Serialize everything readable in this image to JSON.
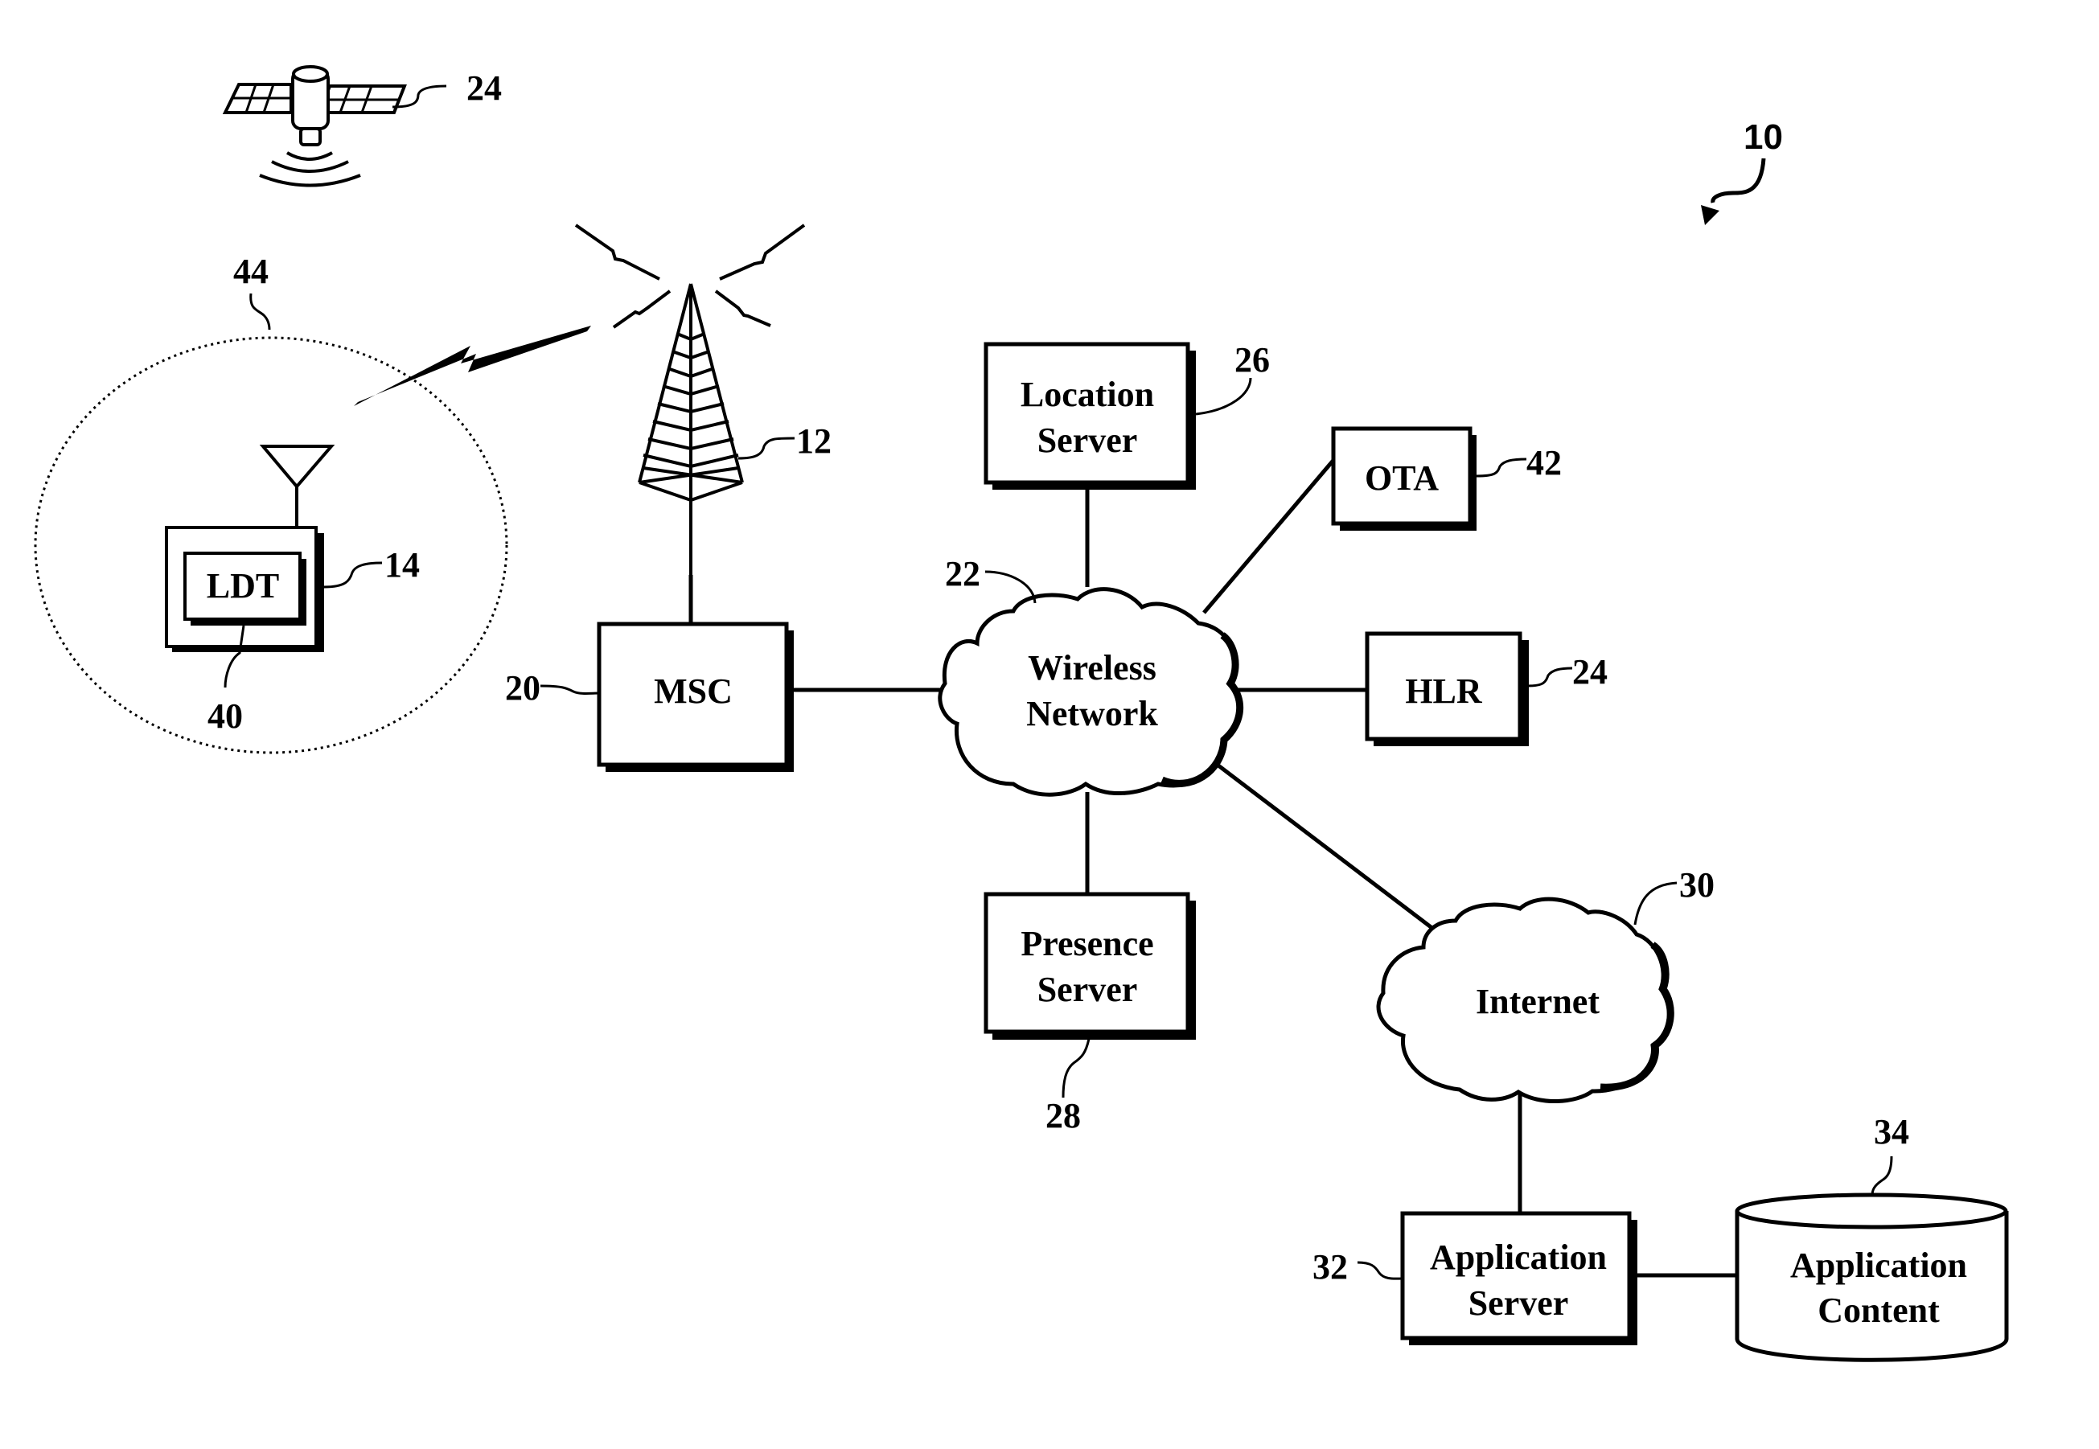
{
  "figure": {
    "reference": "10",
    "nodes": {
      "satellite": {
        "ref": "24",
        "icon": "satellite-icon"
      },
      "tower": {
        "ref": "12",
        "icon": "cell-tower-icon"
      },
      "coverage_area": {
        "ref": "44"
      },
      "device": {
        "ref": "14",
        "label": "LDT",
        "ldt_ref": "40"
      },
      "msc": {
        "ref": "20",
        "lines": [
          "MSC"
        ]
      },
      "wireless_network": {
        "ref": "22",
        "lines": [
          "Wireless",
          "Network"
        ]
      },
      "location_server": {
        "ref": "26",
        "lines": [
          "Location",
          "Server"
        ]
      },
      "ota": {
        "ref": "42",
        "lines": [
          "OTA"
        ]
      },
      "hlr": {
        "ref": "24",
        "lines": [
          "HLR"
        ]
      },
      "presence_server": {
        "ref": "28",
        "lines": [
          "Presence",
          "Server"
        ]
      },
      "internet": {
        "ref": "30",
        "lines": [
          "Internet"
        ]
      },
      "application_server": {
        "ref": "32",
        "lines": [
          "Application",
          "Server"
        ]
      },
      "application_content": {
        "ref": "34",
        "lines": [
          "Application",
          "Content"
        ]
      }
    },
    "connections": [
      [
        "tower",
        "msc"
      ],
      [
        "msc",
        "wireless_network"
      ],
      [
        "location_server",
        "wireless_network"
      ],
      [
        "ota",
        "wireless_network"
      ],
      [
        "hlr",
        "wireless_network"
      ],
      [
        "presence_server",
        "wireless_network"
      ],
      [
        "internet",
        "wireless_network"
      ],
      [
        "internet",
        "application_server"
      ],
      [
        "application_server",
        "application_content"
      ]
    ]
  }
}
